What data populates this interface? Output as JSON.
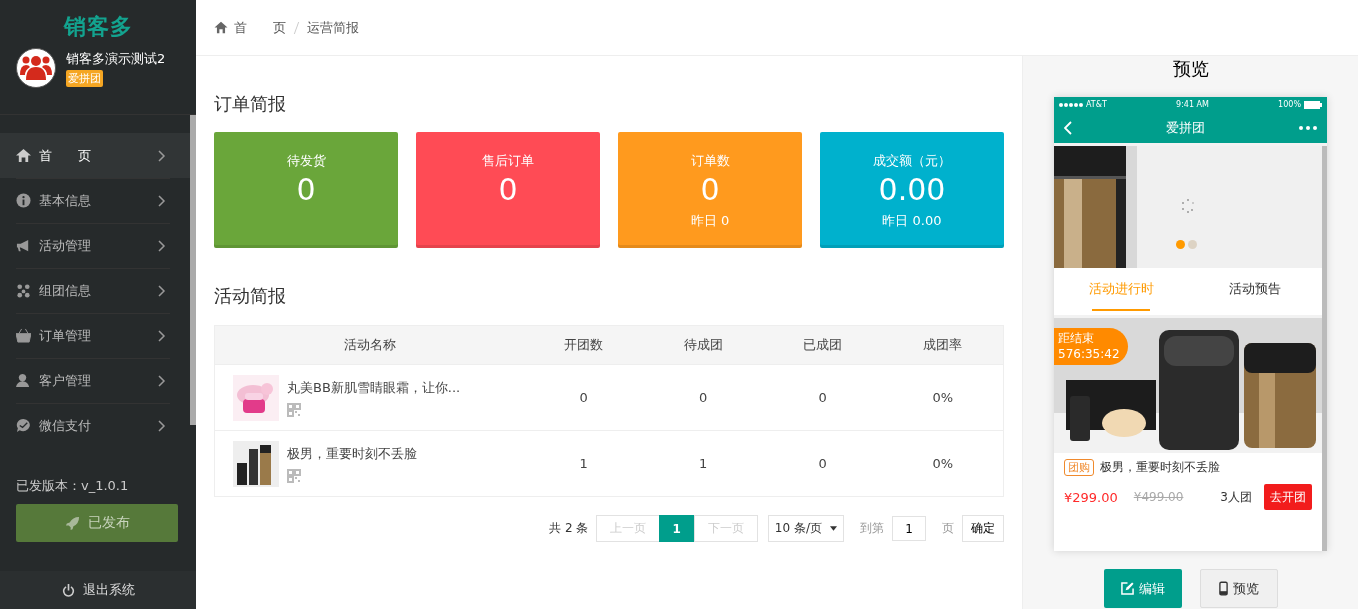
{
  "sidebar": {
    "brand": "销客多",
    "account": {
      "name": "销客多演示测试2",
      "badge": "爱拼团"
    },
    "menu": [
      {
        "label": "首　　页",
        "kind": "home",
        "selected": true
      },
      {
        "label": "基本信息",
        "kind": "info",
        "selected": false
      },
      {
        "label": "活动管理",
        "kind": "megaphone",
        "selected": false
      },
      {
        "label": "组团信息",
        "kind": "cluster",
        "selected": false
      },
      {
        "label": "订单管理",
        "kind": "basket",
        "selected": false
      },
      {
        "label": "客户管理",
        "kind": "user",
        "selected": false
      },
      {
        "label": "微信支付",
        "kind": "chat",
        "selected": false
      }
    ],
    "version": "已发版本：v_1.0.1",
    "publish_button": "已发布",
    "logout": "退出系统"
  },
  "breadcrumb": [
    "首　　页",
    "运营简报"
  ],
  "order_summary": {
    "title": "订单简报",
    "cards": [
      {
        "title": "待发货",
        "value": "0",
        "color": "#6aa63a"
      },
      {
        "title": "售后订单",
        "value": "0",
        "color": "#ff4b55"
      },
      {
        "title": "订单数",
        "value": "0",
        "yesterday": "昨日 0",
        "color": "#ff9a1e"
      },
      {
        "title": "成交额（元）",
        "value": "0.00",
        "yesterday": "昨日 0.00",
        "color": "#00b1cd"
      }
    ]
  },
  "activity_summary": {
    "title": "活动简报",
    "columns": [
      "活动名称",
      "开团数",
      "待成团",
      "已成团",
      "成团率"
    ],
    "rows": [
      {
        "cells": [
          "丸美BB新肌雪睛眼霜，让你...",
          "0",
          "0",
          "0",
          "0%"
        ]
      },
      {
        "cells": [
          "极男，重要时刻不丢脸",
          "1",
          "1",
          "0",
          "0%"
        ]
      }
    ],
    "pagination": {
      "total": "共 2 条",
      "prev": {
        "label": "上一页",
        "disabled": true
      },
      "pages": [
        {
          "label": "1",
          "selected": true
        }
      ],
      "next": {
        "label": "下一页",
        "disabled": true
      },
      "page_size": "10 条/页",
      "goto": "到第",
      "goto_value": "1",
      "page_unit": "页",
      "confirm": "确定"
    }
  },
  "preview": {
    "title": "预览",
    "phone": {
      "carrier": "AT&T",
      "time": "9:41 AM",
      "battery": "100%",
      "nav_title": "爱拼团",
      "dots": [
        {
          "selected": true
        },
        {
          "selected": false
        }
      ],
      "tabs": [
        {
          "label": "活动进行时",
          "selected": true
        },
        {
          "label": "活动预告",
          "selected": false
        }
      ],
      "product": {
        "countdown_label": "距结束",
        "countdown": "576:35:42",
        "tag": "团购",
        "title": "极男，重要时刻不丢脸",
        "price": "¥299.00",
        "old_price": "¥499.00",
        "group_size": "3人团",
        "button": "去开团"
      }
    },
    "buttons": [
      {
        "label": "编辑",
        "kind": "edit"
      },
      {
        "label": "预览",
        "kind": "phone"
      }
    ]
  }
}
